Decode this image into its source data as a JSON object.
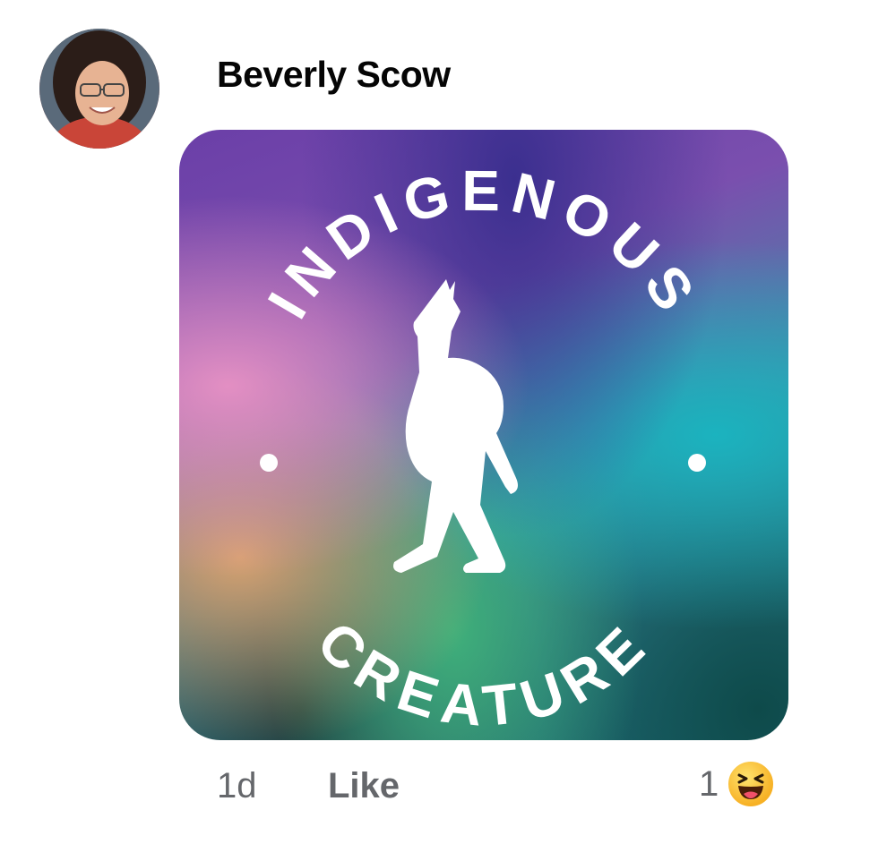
{
  "comment": {
    "author": "Beverly Scow",
    "timestamp": "1d",
    "like_label": "Like",
    "reaction_count": "1",
    "reaction_icon": "haha-reaction-icon"
  },
  "image": {
    "text_top": "INDIGENOUS",
    "text_bottom": "CREATURE",
    "figure": "bigfoot-rock-hand-silhouette"
  },
  "colors": {
    "text_primary": "#050505",
    "text_secondary": "#65676b",
    "reaction_yellow": "#f7b125"
  }
}
